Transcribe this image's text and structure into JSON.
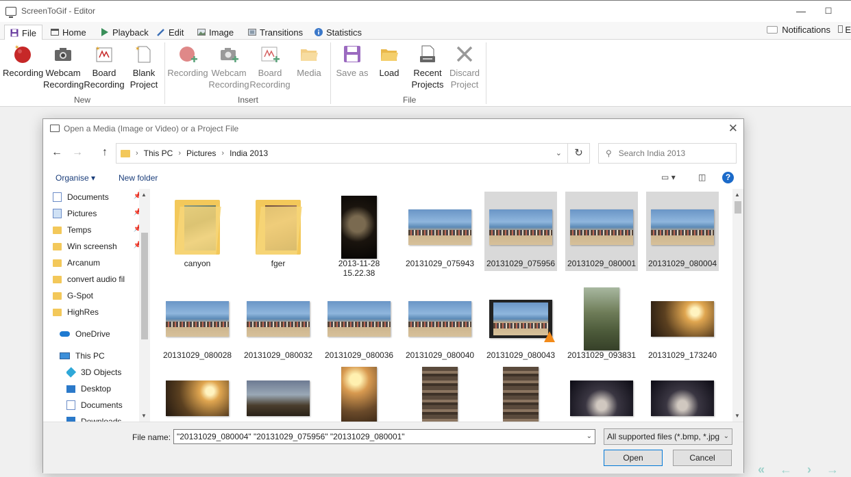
{
  "window": {
    "title": "ScreenToGif - Editor"
  },
  "tabs": [
    {
      "label": "File",
      "icon": "save-icon"
    },
    {
      "label": "Home",
      "icon": "home-icon"
    },
    {
      "label": "Playback",
      "icon": "play-icon"
    },
    {
      "label": "Edit",
      "icon": "pencil-icon"
    },
    {
      "label": "Image",
      "icon": "image-icon"
    },
    {
      "label": "Transitions",
      "icon": "transitions-icon"
    },
    {
      "label": "Statistics",
      "icon": "info-icon"
    }
  ],
  "notifications": {
    "label": "Notifications",
    "extra": "E"
  },
  "ribbon": {
    "groups": {
      "new": "New",
      "insert": "Insert",
      "file": "File"
    },
    "new": [
      {
        "line1": "Recording",
        "line2": ""
      },
      {
        "line1": "Webcam",
        "line2": "Recording"
      },
      {
        "line1": "Board",
        "line2": "Recording"
      },
      {
        "line1": "Blank",
        "line2": "Project"
      }
    ],
    "insert": [
      {
        "line1": "Recording",
        "line2": ""
      },
      {
        "line1": "Webcam",
        "line2": "Recording"
      },
      {
        "line1": "Board",
        "line2": "Recording"
      },
      {
        "line1": "Media",
        "line2": ""
      }
    ],
    "file": [
      {
        "line1": "Save as",
        "line2": ""
      },
      {
        "line1": "Load",
        "line2": ""
      },
      {
        "line1": "Recent",
        "line2": "Projects"
      },
      {
        "line1": "Discard",
        "line2": "Project"
      }
    ]
  },
  "dialog": {
    "title": "Open a Media (Image or Video) or a Project File",
    "breadcrumb": [
      "This PC",
      "Pictures",
      "India 2013"
    ],
    "search_placeholder": "Search India 2013",
    "toolbar": {
      "organise": "Organise",
      "new_folder": "New folder"
    },
    "nav": [
      {
        "label": "Documents",
        "icon": "documents-icon",
        "pinned": true
      },
      {
        "label": "Pictures",
        "icon": "pictures-icon",
        "pinned": true
      },
      {
        "label": "Temps",
        "icon": "folder-icon",
        "pinned": true
      },
      {
        "label": "Win screensh",
        "icon": "folder-icon",
        "pinned": true
      },
      {
        "label": "Arcanum",
        "icon": "folder-icon",
        "pinned": false
      },
      {
        "label": "convert audio fil",
        "icon": "folder-icon",
        "pinned": false
      },
      {
        "label": "G-Spot",
        "icon": "folder-icon",
        "pinned": false
      },
      {
        "label": "HighRes",
        "icon": "folder-icon",
        "pinned": false
      },
      {
        "label": "OneDrive",
        "icon": "cloud-icon",
        "pinned": false
      },
      {
        "label": "This PC",
        "icon": "computer-icon",
        "pinned": false
      },
      {
        "label": "3D Objects",
        "icon": "cube-icon",
        "pinned": false
      },
      {
        "label": "Desktop",
        "icon": "desktop-icon",
        "pinned": false
      },
      {
        "label": "Documents",
        "icon": "documents-icon",
        "pinned": false
      },
      {
        "label": "Downloads",
        "icon": "downloads-icon",
        "pinned": false
      }
    ],
    "files": [
      {
        "name": "canyon",
        "kind": "folder",
        "selected": false
      },
      {
        "name": "fger",
        "kind": "folder",
        "selected": false
      },
      {
        "name": "2013-11-28 15.22.38",
        "kind": "dark",
        "selected": false
      },
      {
        "name": "20131029_075943",
        "kind": "beach",
        "selected": false
      },
      {
        "name": "20131029_075956",
        "kind": "beach",
        "selected": true
      },
      {
        "name": "20131029_080001",
        "kind": "beach",
        "selected": true
      },
      {
        "name": "20131029_080004",
        "kind": "beach",
        "selected": true
      },
      {
        "name": "20131029_080028",
        "kind": "beach",
        "selected": false
      },
      {
        "name": "20131029_080032",
        "kind": "beach",
        "selected": false
      },
      {
        "name": "20131029_080036",
        "kind": "beach",
        "selected": false
      },
      {
        "name": "20131029_080040",
        "kind": "beach",
        "selected": false
      },
      {
        "name": "20131029_080043",
        "kind": "video",
        "selected": false
      },
      {
        "name": "20131029_093831",
        "kind": "temple",
        "selected": false
      },
      {
        "name": "20131029_173240",
        "kind": "sunset",
        "selected": false
      },
      {
        "name": "",
        "kind": "sunset",
        "selected": false
      },
      {
        "name": "",
        "kind": "dusk",
        "selected": false
      },
      {
        "name": "",
        "kind": "portrait-sunset",
        "selected": false
      },
      {
        "name": "",
        "kind": "carving",
        "selected": false
      },
      {
        "name": "",
        "kind": "carving",
        "selected": false
      },
      {
        "name": "",
        "kind": "night",
        "selected": false
      },
      {
        "name": "",
        "kind": "night",
        "selected": false
      }
    ],
    "file_name_label": "File name:",
    "file_name_value": "\"20131029_080004\" \"20131029_075956\" \"20131029_080001\"",
    "file_type": "All supported files (*.bmp, *.jpg",
    "open_label": "Open",
    "cancel_label": "Cancel"
  }
}
